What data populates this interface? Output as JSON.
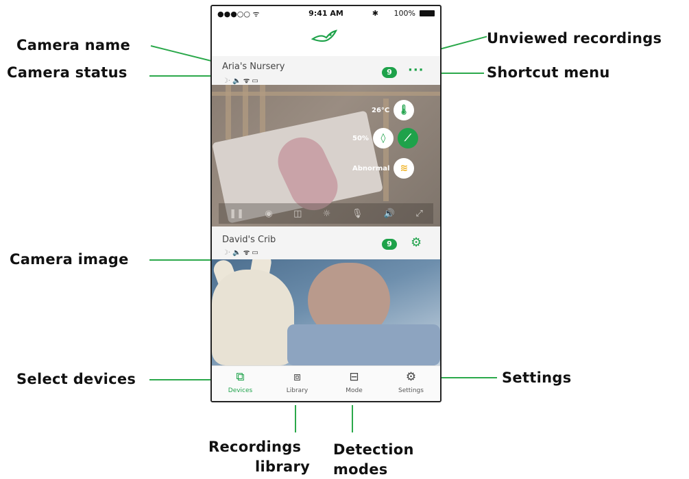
{
  "callouts": {
    "camera_name": "Camera name",
    "camera_status": "Camera status",
    "camera_image": "Camera image",
    "select_devices": "Select devices",
    "unviewed_recordings": "Unviewed recordings",
    "shortcut_menu": "Shortcut menu",
    "settings": "Settings",
    "recordings_library_line1": "Recordings",
    "recordings_library_line2": "library",
    "detection_modes_line1": "Detection",
    "detection_modes_line2": "modes"
  },
  "status_bar": {
    "signal": "●●●○○ ᯤ",
    "time": "9:41 AM",
    "bluetooth": "✱",
    "battery": "100%"
  },
  "cameras": [
    {
      "name": "Aria's Nursery",
      "unviewed": "9",
      "action": "shortcut-menu",
      "sensors": {
        "temperature": "26°C",
        "humidity": "50%",
        "breathing": "Abnormal"
      }
    },
    {
      "name": "David's Crib",
      "unviewed": "9",
      "action": "settings"
    }
  ],
  "tabs": [
    {
      "label": "Devices",
      "icon": "devices-icon",
      "active": true
    },
    {
      "label": "Library",
      "icon": "library-icon",
      "active": false
    },
    {
      "label": "Mode",
      "icon": "mode-icon",
      "active": false
    },
    {
      "label": "Settings",
      "icon": "gear-icon",
      "active": false
    }
  ],
  "colors": {
    "accent": "#1ea24a",
    "callout_line": "#2aa84a",
    "alert": "#f0b429"
  }
}
